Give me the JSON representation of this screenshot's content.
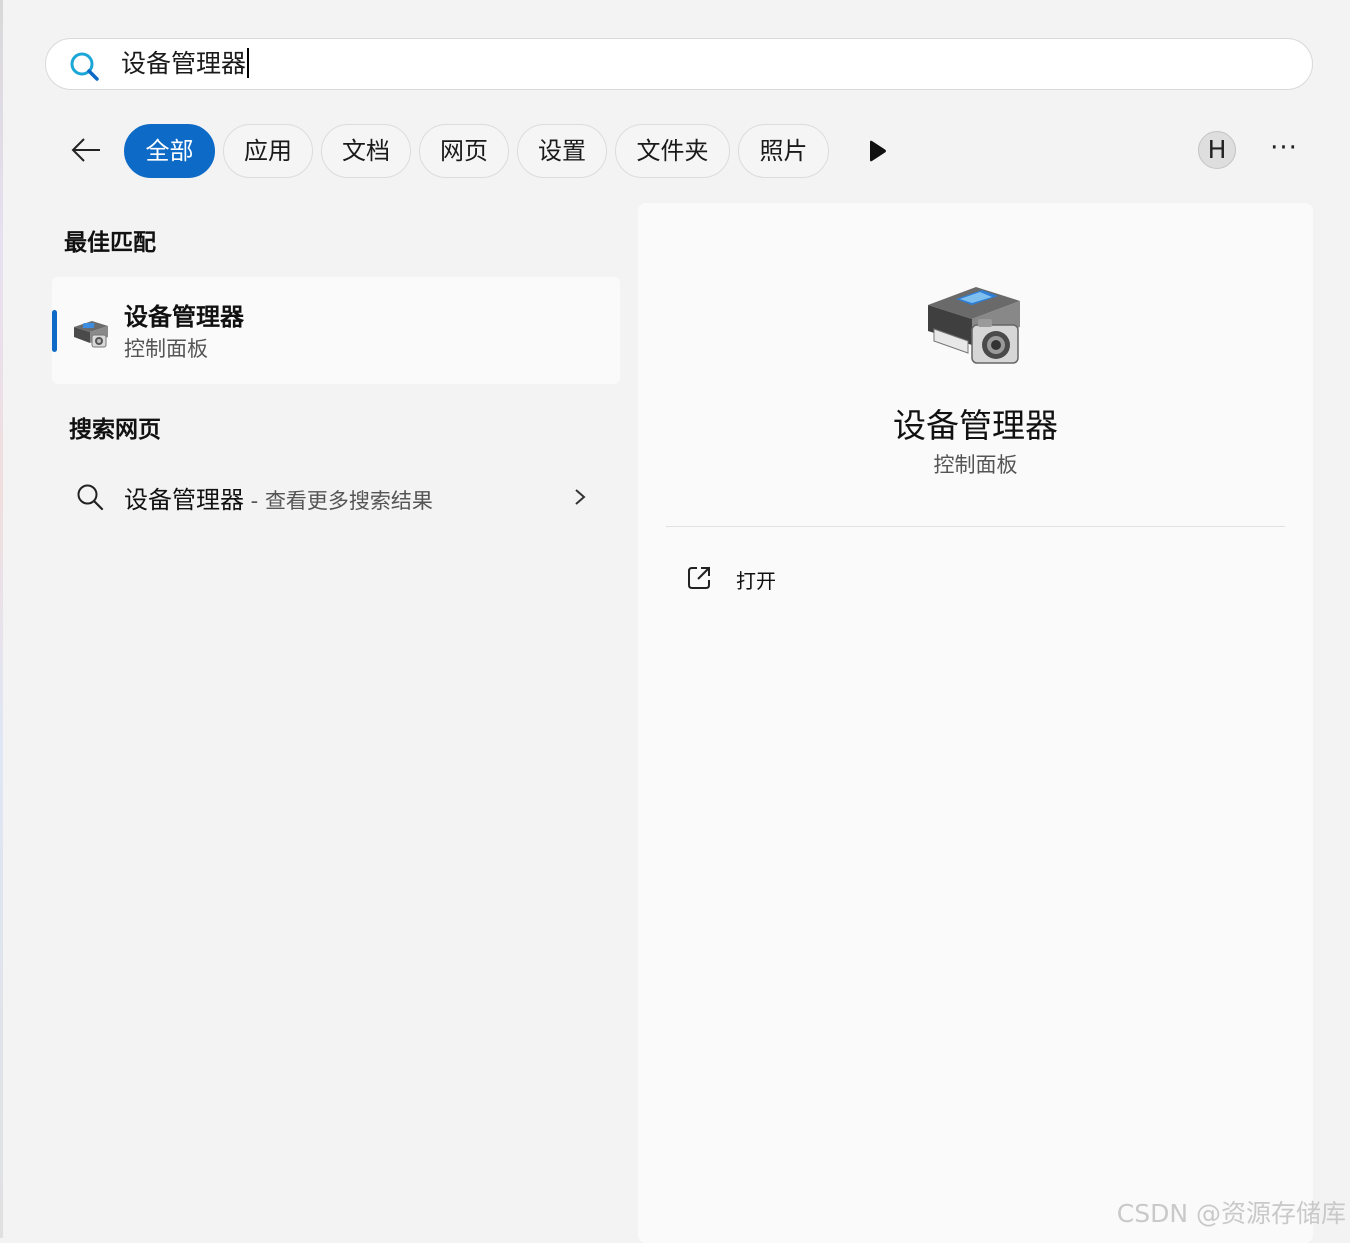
{
  "search": {
    "query": "设备管理器"
  },
  "filters": {
    "back_icon": "arrow-left-icon",
    "chips": [
      "全部",
      "应用",
      "文档",
      "网页",
      "设置",
      "文件夹",
      "照片"
    ],
    "active_chip": "全部",
    "accent_color": "#0e6ac7",
    "more_results_icon": "play-triangle-icon"
  },
  "account": {
    "avatar_initial": "H",
    "more_label": "···"
  },
  "best_match": {
    "heading": "最佳匹配",
    "title": "设备管理器",
    "subtitle": "控制面板",
    "icon": "device-manager-icon"
  },
  "web_search": {
    "heading": "搜索网页",
    "query": "设备管理器",
    "separator": " - ",
    "hint": "查看更多搜索结果",
    "icon": "search-icon"
  },
  "preview": {
    "title": "设备管理器",
    "subtitle": "控制面板",
    "actions": [
      {
        "label": "打开",
        "icon": "open-external-icon"
      }
    ]
  },
  "watermark": "CSDN @资源存储库"
}
